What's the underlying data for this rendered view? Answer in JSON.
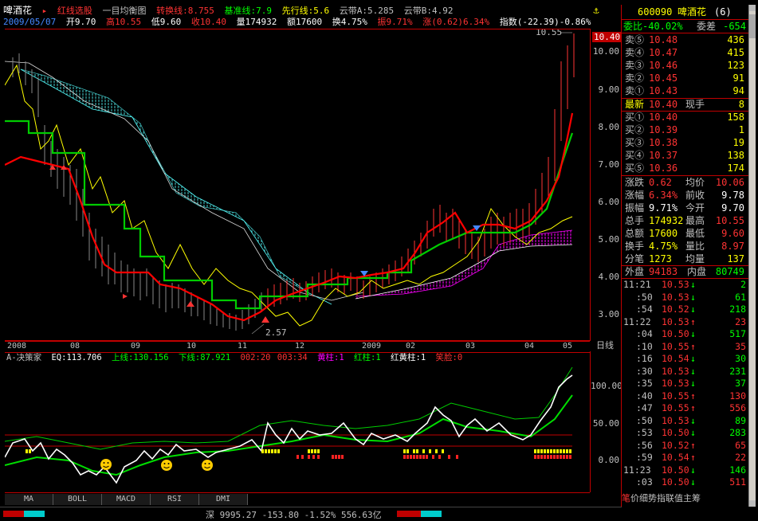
{
  "header": {
    "stock_name": "啤酒花",
    "indicator_label": "红线选股",
    "ichimoku_title": "一目均衡图",
    "tenkan": "转换线:8.755",
    "kijun": "基准线:7.9",
    "chikou": "先行线:5.6",
    "cloud_a": "云带A:5.285",
    "cloud_b": "云带B:4.92"
  },
  "info_line": {
    "date": "2009/05/07",
    "open": "开9.70",
    "high": "高10.55",
    "low": "低9.60",
    "close": "收10.40",
    "volume": "量174932",
    "amount": "额17600",
    "turnover": "换4.75%",
    "amplitude": "振9.71%",
    "change": "涨(0.62)6.34%",
    "index": "指数(-22.39)-0.86%"
  },
  "price_chart": {
    "y_labels": [
      "10.00",
      "9.00",
      "8.00",
      "7.00",
      "6.00",
      "5.00",
      "4.00",
      "3.00"
    ],
    "max_label": "10.55",
    "min_label": "2.57",
    "last_price_tag": "10.40",
    "x_labels": [
      "2008",
      "08",
      "09",
      "10",
      "11",
      "12",
      "2009",
      "02",
      "03",
      "04",
      "05"
    ],
    "period_tab": "日线"
  },
  "sub_chart": {
    "title": "A-决策家",
    "eq": "EQ:113.706",
    "upper": "上线:130.156",
    "lower": "下线:87.921",
    "t1": "002:20",
    "t2": "003:34",
    "yellow_bar": "黄柱:1",
    "red_bar": "红柱:1",
    "red_yellow_bar": "红黄柱:1",
    "smile": "笑脸:0",
    "y_labels": [
      "100.00",
      "50.00",
      "0.00"
    ]
  },
  "tabs": [
    "MA",
    "BOLL",
    "MACD",
    "RSI",
    "DMI"
  ],
  "status_bar": "深 9995.27 -153.80 -1.52% 556.63亿",
  "quote": {
    "code": "600090",
    "name": "啤酒花",
    "badge": "(6)",
    "weibi": "委比-40.02%",
    "weicha_label": "委差",
    "weicha": "-654",
    "asks": [
      {
        "label": "卖⑤",
        "price": "10.48",
        "vol": "436"
      },
      {
        "label": "卖④",
        "price": "10.47",
        "vol": "415"
      },
      {
        "label": "卖③",
        "price": "10.46",
        "vol": "123"
      },
      {
        "label": "卖②",
        "price": "10.45",
        "vol": "91"
      },
      {
        "label": "卖①",
        "price": "10.43",
        "vol": "94"
      }
    ],
    "latest_label": "最新",
    "latest": "10.40",
    "hand_label": "现手",
    "hand": "8",
    "bids": [
      {
        "label": "买①",
        "price": "10.40",
        "vol": "158"
      },
      {
        "label": "买②",
        "price": "10.39",
        "vol": "1"
      },
      {
        "label": "买③",
        "price": "10.38",
        "vol": "19"
      },
      {
        "label": "买④",
        "price": "10.37",
        "vol": "138"
      },
      {
        "label": "买⑤",
        "price": "10.36",
        "vol": "174"
      }
    ],
    "stats": [
      {
        "l1": "涨跌",
        "v1": "0.62",
        "l2": "均价",
        "v2": "10.06"
      },
      {
        "l1": "涨幅",
        "v1": "6.34%",
        "l2": "前收",
        "v2": "9.78"
      },
      {
        "l1": "振幅",
        "v1": "9.71%",
        "l2": "今开",
        "v2": "9.70"
      },
      {
        "l1": "总手",
        "v1": "174932",
        "l2": "最高",
        "v2": "10.55"
      },
      {
        "l1": "总额",
        "v1": "17600",
        "l2": "最低",
        "v2": "9.60"
      },
      {
        "l1": "换手",
        "v1": "4.75%",
        "l2": "量比",
        "v2": "8.97"
      },
      {
        "l1": "分笔",
        "v1": "1273",
        "l2": "均量",
        "v2": "137"
      }
    ],
    "outer_label": "外盘",
    "outer": "94183",
    "inner_label": "内盘",
    "inner": "80749",
    "ticks": [
      {
        "t": "11:21",
        "p": "10.53",
        "v": "2",
        "d": "↓"
      },
      {
        "t": ":50",
        "p": "10.53",
        "v": "61",
        "d": "↓"
      },
      {
        "t": ":54",
        "p": "10.52",
        "v": "218",
        "d": "↓"
      },
      {
        "t": "11:22",
        "p": "10.53",
        "v": "23",
        "d": "↑"
      },
      {
        "t": ":04",
        "p": "10.50",
        "v": "517",
        "d": "↓"
      },
      {
        "t": ":10",
        "p": "10.55",
        "v": "35",
        "d": "↑"
      },
      {
        "t": ":16",
        "p": "10.54",
        "v": "30",
        "d": "↓"
      },
      {
        "t": ":30",
        "p": "10.53",
        "v": "231",
        "d": "↓"
      },
      {
        "t": ":35",
        "p": "10.53",
        "v": "37",
        "d": "↓"
      },
      {
        "t": ":40",
        "p": "10.55",
        "v": "130",
        "d": "↑"
      },
      {
        "t": ":47",
        "p": "10.55",
        "v": "556",
        "d": "↑"
      },
      {
        "t": ":50",
        "p": "10.53",
        "v": "89",
        "d": "↓"
      },
      {
        "t": ":53",
        "p": "10.50",
        "v": "283",
        "d": "↓"
      },
      {
        "t": ":56",
        "p": "10.52",
        "v": "65",
        "d": "↑"
      },
      {
        "t": ":59",
        "p": "10.54",
        "v": "22",
        "d": "↑"
      },
      {
        "t": "11:23",
        "p": "10.50",
        "v": "146",
        "d": "↓"
      },
      {
        "t": ":03",
        "p": "10.50",
        "v": "511",
        "d": "↓"
      }
    ],
    "footer_tabs": [
      "笔",
      "价",
      "细",
      "势",
      "指",
      "联",
      "值",
      "主",
      "筹"
    ]
  },
  "colors": {
    "up": "#ff3333",
    "down": "#00ff00",
    "neutral": "#c0c0c0",
    "frame": "#c00000"
  }
}
